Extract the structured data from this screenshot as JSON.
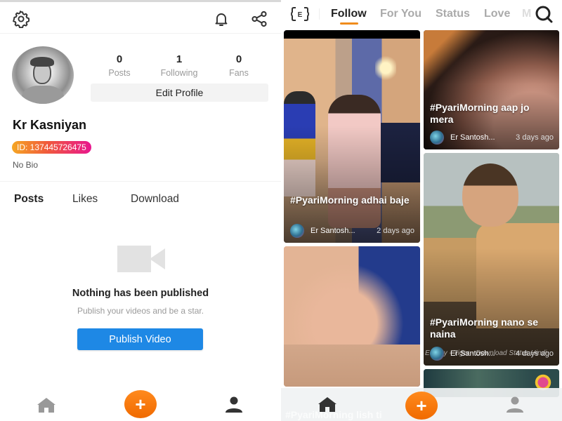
{
  "profile_screen": {
    "header": {
      "settings_icon": "gear-icon",
      "notifications_icon": "bell-icon",
      "share_icon": "share-icon"
    },
    "user": {
      "name": "Kr Kasniyan",
      "id_label": "ID: 137445726475",
      "bio": "No Bio"
    },
    "stats": [
      {
        "value": "0",
        "label": "Posts"
      },
      {
        "value": "1",
        "label": "Following"
      },
      {
        "value": "0",
        "label": "Fans"
      }
    ],
    "edit_profile_label": "Edit Profile",
    "tabs": [
      {
        "label": "Posts",
        "active": true
      },
      {
        "label": "Likes",
        "active": false
      },
      {
        "label": "Download",
        "active": false
      }
    ],
    "empty_state": {
      "icon": "video-camera-icon",
      "title": "Nothing has been published",
      "subtitle": "Publish your videos and be a star.",
      "button_label": "Publish Video"
    },
    "bottom_nav": {
      "items": [
        "home-icon",
        "add-icon",
        "profile-icon"
      ],
      "plus_symbol": "+",
      "active": "profile"
    }
  },
  "feed_screen": {
    "header": {
      "logo_icon": "e-bracket-icon",
      "search_icon": "search-icon",
      "tabs": [
        {
          "label": "Follow",
          "active": true
        },
        {
          "label": "For You",
          "active": false
        },
        {
          "label": "Status",
          "active": false
        },
        {
          "label": "Love",
          "active": false
        },
        {
          "label": "M",
          "active": false
        }
      ]
    },
    "cards": [
      {
        "title": "#PyariMorning adhai baje",
        "author": "Er Santosh...",
        "time": "2 days ago"
      },
      {
        "title": "#PyariMorning aap jo mera",
        "author": "Er Santosh...",
        "time": "3 days ago"
      },
      {
        "title": "",
        "author": "",
        "time": ""
      },
      {
        "title": "#PyariMorning nano se naina",
        "author": "Er Santosh...",
        "time": "4 days ago",
        "watermark": "Edit By - Tiger - Download Status Hindi"
      }
    ],
    "ghost_caption": "#PyariMorning lish ti",
    "bottom_nav": {
      "items": [
        "home-icon",
        "add-icon",
        "profile-icon"
      ],
      "plus_symbol": "+",
      "active": "home"
    },
    "colors": {
      "accent": "#f08c1c",
      "publish_button": "#1e88e5"
    }
  }
}
